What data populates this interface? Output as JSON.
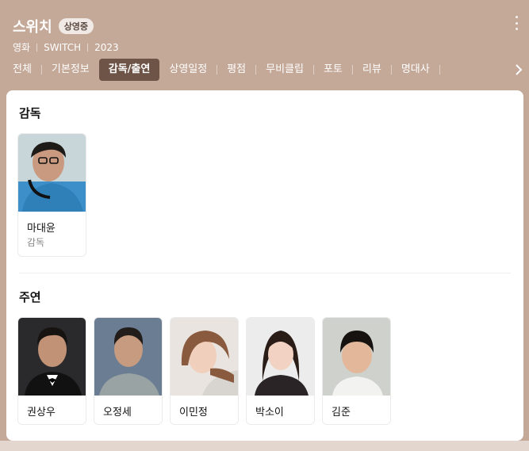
{
  "header": {
    "title": "스위치",
    "badge": "상영중",
    "meta": [
      "영화",
      "SWITCH",
      "2023"
    ]
  },
  "tabs": [
    {
      "label": "전체",
      "active": false
    },
    {
      "label": "기본정보",
      "active": false
    },
    {
      "label": "감독/출연",
      "active": true
    },
    {
      "label": "상영일정",
      "active": false
    },
    {
      "label": "평점",
      "active": false
    },
    {
      "label": "무비클립",
      "active": false
    },
    {
      "label": "포토",
      "active": false
    },
    {
      "label": "리뷰",
      "active": false
    },
    {
      "label": "명대사",
      "active": false
    }
  ],
  "director_section": {
    "title": "감독",
    "people": [
      {
        "name": "마대윤",
        "role": "감독"
      }
    ]
  },
  "cast_section": {
    "title": "주연",
    "people": [
      {
        "name": "권상우"
      },
      {
        "name": "오정세"
      },
      {
        "name": "이민정"
      },
      {
        "name": "박소이"
      },
      {
        "name": "김준"
      }
    ]
  }
}
